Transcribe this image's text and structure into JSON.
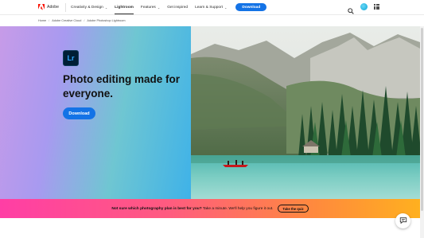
{
  "nav": {
    "brand": "Adobe",
    "items": [
      {
        "label": "Creativity & Design",
        "chevron": true
      },
      {
        "label": "Lightroom",
        "chevron": false,
        "active": true
      },
      {
        "label": "Features",
        "chevron": true
      },
      {
        "label": "Get inspired",
        "chevron": false
      },
      {
        "label": "Learn & Support",
        "chevron": true
      }
    ],
    "download_label": "Download",
    "icons": [
      "search-icon",
      "user-avatar",
      "apps-grid-icon"
    ]
  },
  "breadcrumb": [
    "Home",
    "Adobe Creative Cloud",
    "Adobe Photoshop Lightroom"
  ],
  "hero": {
    "app_icon_text": "Lr",
    "title": "Photo editing made for everyone.",
    "download_label": "Download"
  },
  "promo": {
    "bold_text": "Not sure which photography plan is best for you?",
    "text": " Take a minute. We'll help you figure it out.",
    "button_label": "Take the quiz"
  },
  "colors": {
    "adobe_red": "#fa0f00",
    "primary_blue": "#1473e6",
    "lr_dark": "#001e36",
    "lr_blue": "#31a8ff"
  }
}
